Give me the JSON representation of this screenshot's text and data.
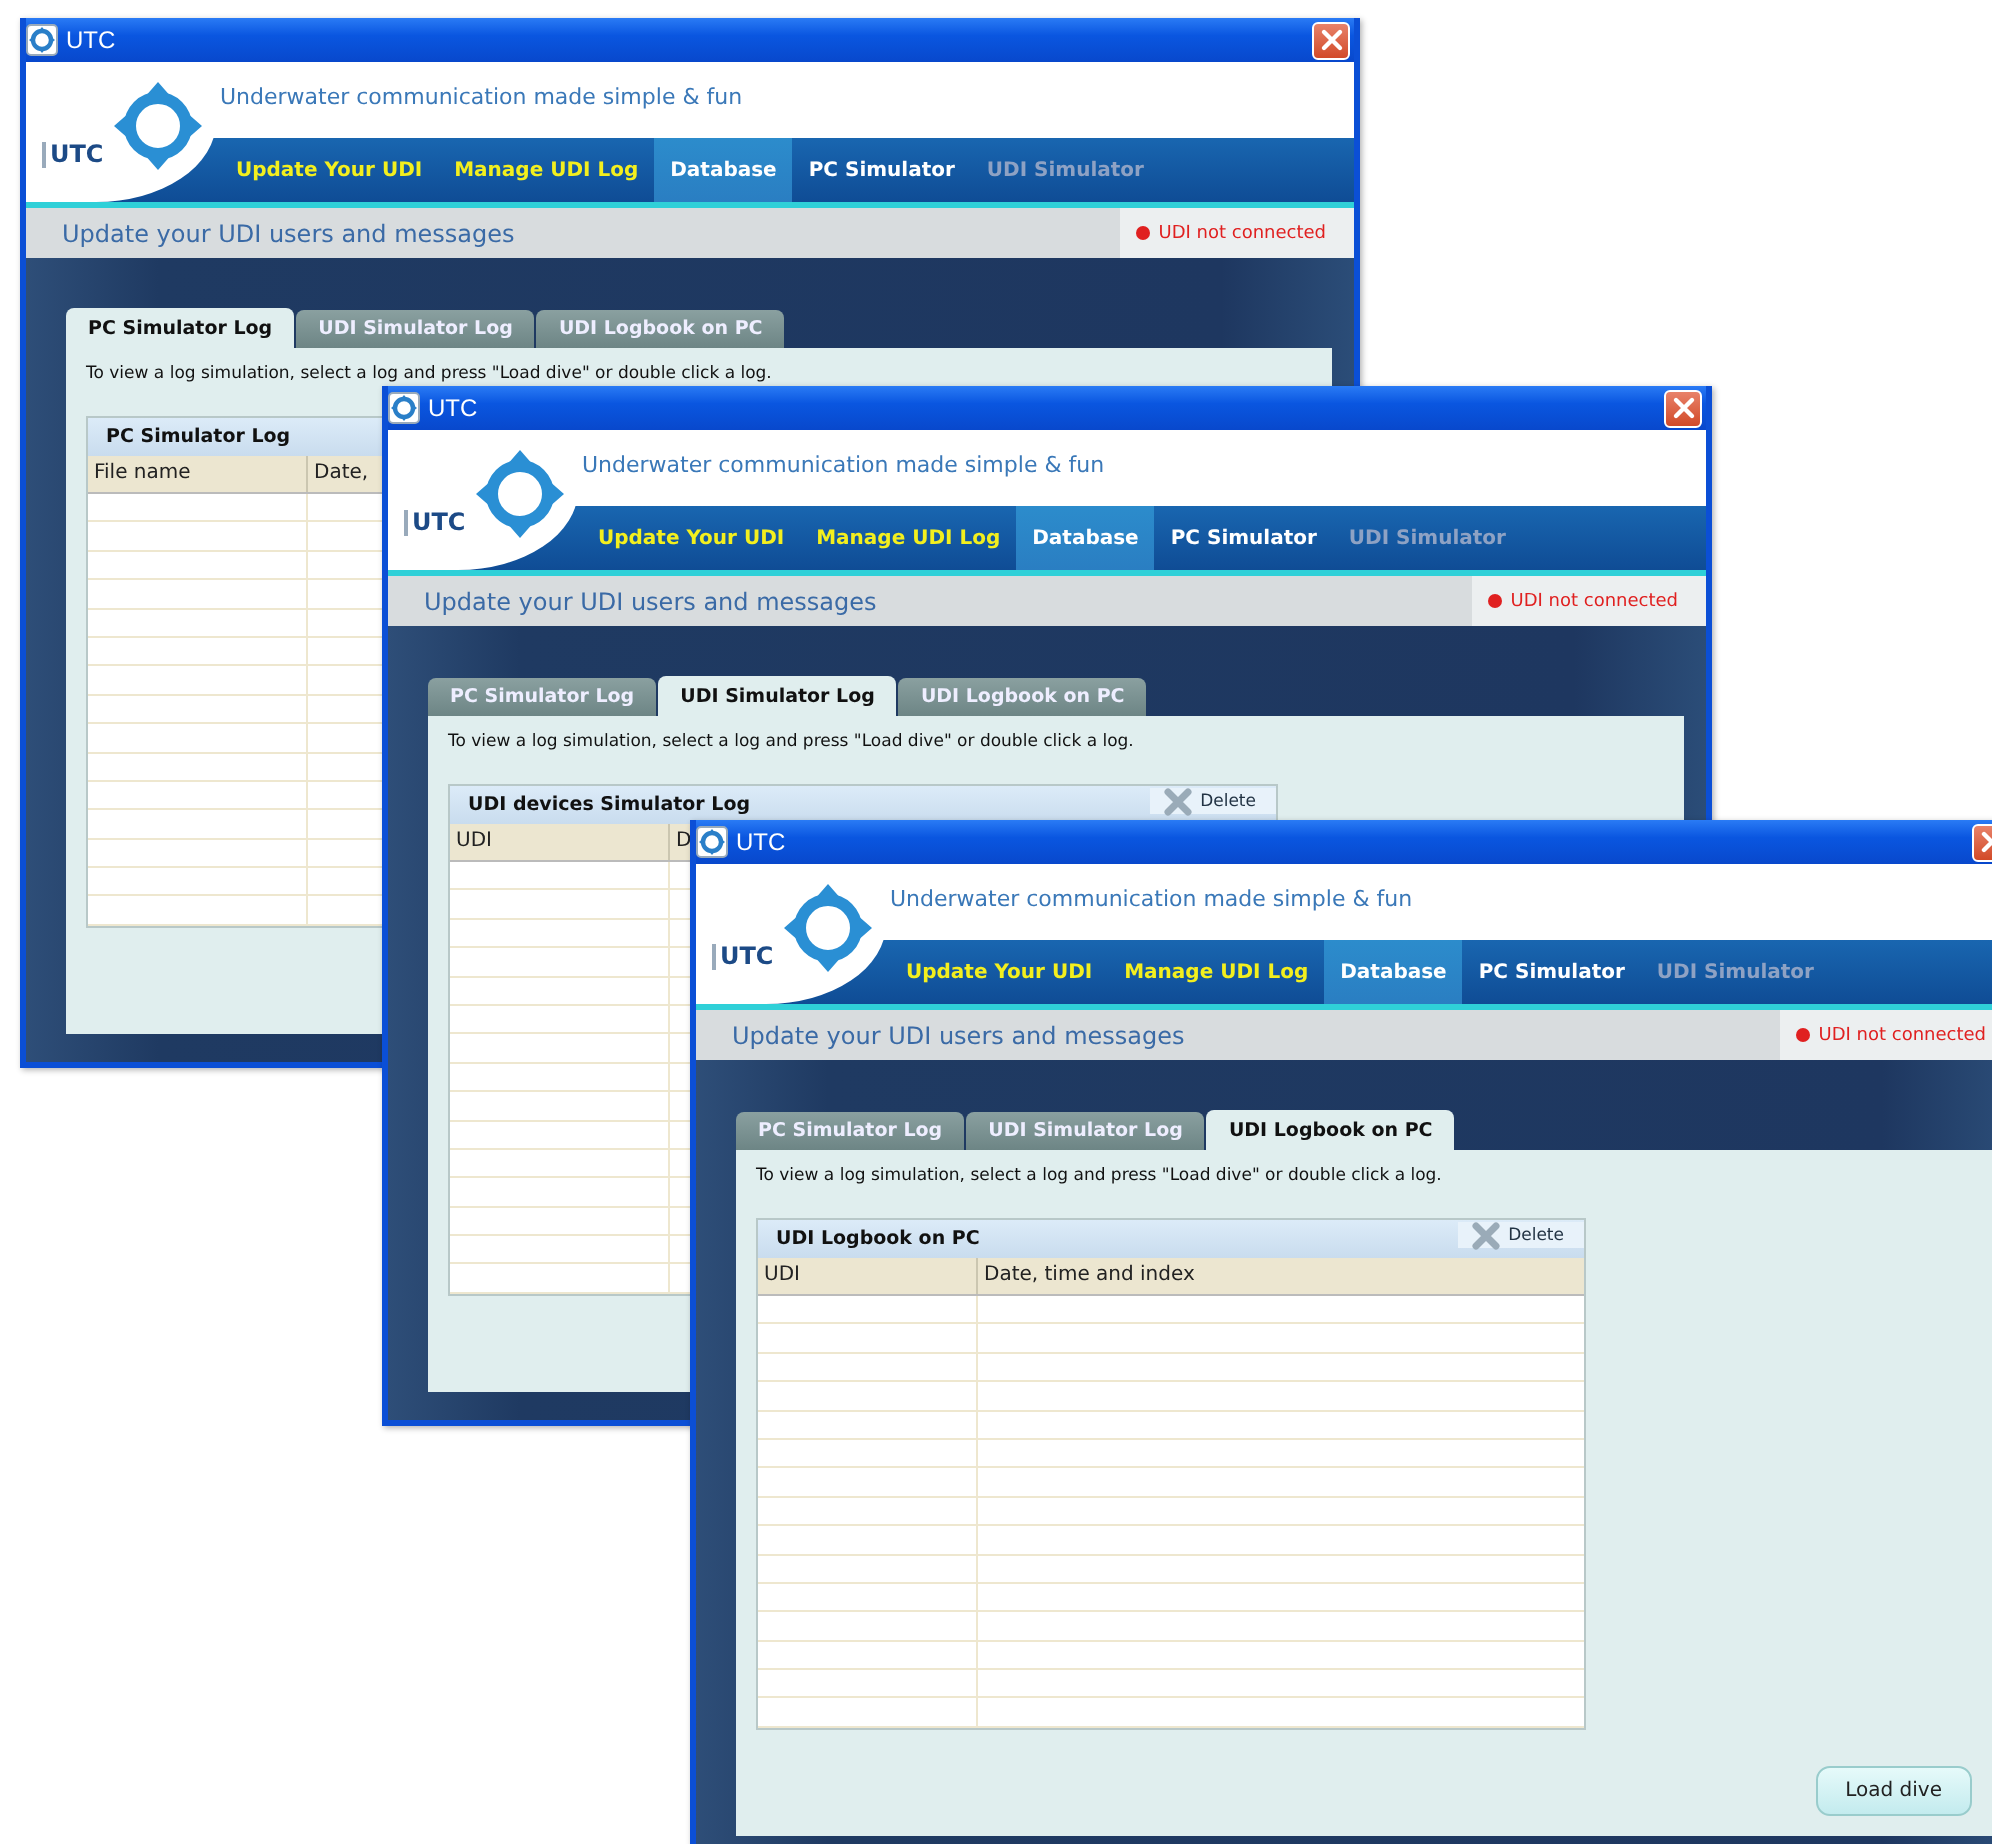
{
  "windows": [
    {
      "title": "UTC",
      "logo_text": "UTC",
      "tagline": "Underwater communication made simple & fun",
      "nav": [
        {
          "label": "Update Your UDI",
          "selected": false,
          "emphasized": true,
          "disabled": false
        },
        {
          "label": "Manage UDI Log",
          "selected": false,
          "emphasized": true,
          "disabled": false
        },
        {
          "label": "Database",
          "selected": true,
          "emphasized": false,
          "disabled": false
        },
        {
          "label": "PC Simulator",
          "selected": false,
          "emphasized": false,
          "disabled": false
        },
        {
          "label": "UDI Simulator",
          "selected": false,
          "emphasized": false,
          "disabled": true
        }
      ],
      "heading": "Update your UDI users and messages",
      "status": {
        "text": "UDI not connected",
        "connected": false
      },
      "tabs": [
        {
          "label": "PC Simulator Log",
          "selected": true
        },
        {
          "label": "UDI Simulator Log",
          "selected": false
        },
        {
          "label": "UDI Logbook on PC",
          "selected": false
        }
      ],
      "instructions": "To view a log simulation, select a log and press \"Load dive\" or double click a log.",
      "table": {
        "title": "PC Simulator Log",
        "columns": [
          "File name",
          "Date,"
        ]
      }
    },
    {
      "title": "UTC",
      "logo_text": "UTC",
      "tagline": "Underwater communication made simple & fun",
      "nav": [
        {
          "label": "Update Your UDI",
          "selected": false,
          "emphasized": true,
          "disabled": false
        },
        {
          "label": "Manage UDI Log",
          "selected": false,
          "emphasized": true,
          "disabled": false
        },
        {
          "label": "Database",
          "selected": true,
          "emphasized": false,
          "disabled": false
        },
        {
          "label": "PC Simulator",
          "selected": false,
          "emphasized": false,
          "disabled": false
        },
        {
          "label": "UDI Simulator",
          "selected": false,
          "emphasized": false,
          "disabled": true
        }
      ],
      "heading": "Update your UDI users and messages",
      "status": {
        "text": "UDI not connected",
        "connected": false
      },
      "tabs": [
        {
          "label": "PC Simulator Log",
          "selected": false
        },
        {
          "label": "UDI Simulator Log",
          "selected": true
        },
        {
          "label": "UDI Logbook on PC",
          "selected": false
        }
      ],
      "instructions": "To view a log simulation, select a log and press \"Load dive\" or double click a log.",
      "table": {
        "title": "UDI devices Simulator Log",
        "delete_label": "Delete",
        "columns": [
          "UDI",
          "D"
        ]
      }
    },
    {
      "title": "UTC",
      "logo_text": "UTC",
      "tagline": "Underwater communication made simple & fun",
      "nav": [
        {
          "label": "Update Your UDI",
          "selected": false,
          "emphasized": true,
          "disabled": false
        },
        {
          "label": "Manage UDI Log",
          "selected": false,
          "emphasized": true,
          "disabled": false
        },
        {
          "label": "Database",
          "selected": true,
          "emphasized": false,
          "disabled": false
        },
        {
          "label": "PC Simulator",
          "selected": false,
          "emphasized": false,
          "disabled": false
        },
        {
          "label": "UDI Simulator",
          "selected": false,
          "emphasized": false,
          "disabled": true
        }
      ],
      "heading": "Update your UDI users and messages",
      "status": {
        "text": "UDI not connected",
        "connected": false
      },
      "tabs": [
        {
          "label": "PC Simulator Log",
          "selected": false
        },
        {
          "label": "UDI Simulator Log",
          "selected": false
        },
        {
          "label": "UDI Logbook on PC",
          "selected": true
        }
      ],
      "instructions": "To view a log simulation, select a log and press \"Load dive\" or double click a log.",
      "table": {
        "title": "UDI Logbook on PC",
        "delete_label": "Delete",
        "columns": [
          "UDI",
          "Date, time and index"
        ]
      },
      "load_button": "Load dive"
    }
  ]
}
